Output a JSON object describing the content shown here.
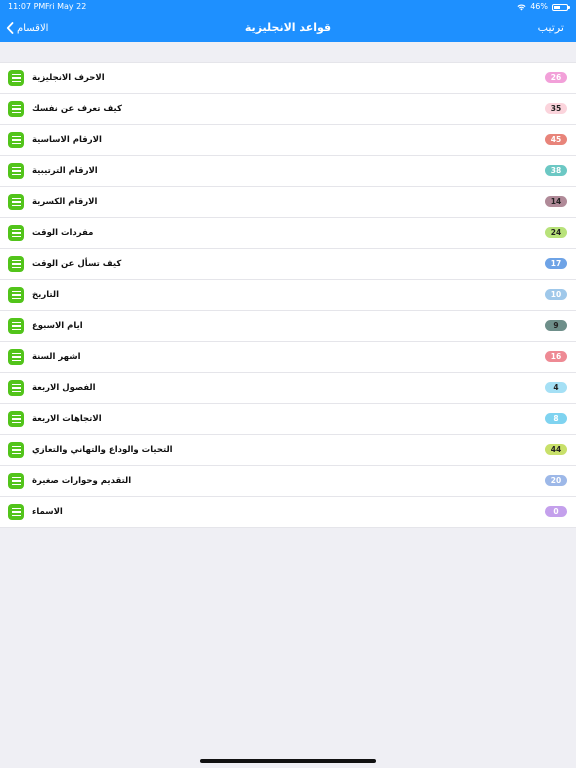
{
  "status_bar": {
    "time": "11:07 PM",
    "date": "Fri May 22",
    "battery_text": "46%",
    "battery_level": 0.46
  },
  "nav": {
    "title": "قواعد الانجليزية",
    "back_label": "الاقسام",
    "sort_label": "ترتيب",
    "color": "#1e90ff"
  },
  "items": [
    {
      "title": "الاحرف الانجليزية",
      "count": "26",
      "badge_color": "#f2a0d9",
      "text_color": "#ffffff"
    },
    {
      "title": "كيف تعرف عن نفسك",
      "count": "35",
      "badge_color": "#fbd4dc",
      "text_color": "#222222"
    },
    {
      "title": "الارقام الاساسية",
      "count": "45",
      "badge_color": "#e8847a",
      "text_color": "#ffffff"
    },
    {
      "title": "الارقام الترتيبية",
      "count": "38",
      "badge_color": "#6cc8c4",
      "text_color": "#ffffff"
    },
    {
      "title": "الارقام الكسرية",
      "count": "14",
      "badge_color": "#b08a98",
      "text_color": "#222222"
    },
    {
      "title": "مفردات الوقت",
      "count": "24",
      "badge_color": "#b8e27a",
      "text_color": "#222222"
    },
    {
      "title": "كيف تسأل عن الوقت",
      "count": "17",
      "badge_color": "#6ea3e6",
      "text_color": "#ffffff"
    },
    {
      "title": "التاريخ",
      "count": "10",
      "badge_color": "#9fc8ea",
      "text_color": "#ffffff"
    },
    {
      "title": "ايام الاسبوع",
      "count": "9",
      "badge_color": "#6e8f8a",
      "text_color": "#222222"
    },
    {
      "title": "اشهر السنة",
      "count": "16",
      "badge_color": "#ee8a94",
      "text_color": "#ffffff"
    },
    {
      "title": "الفصول الاربعة",
      "count": "4",
      "badge_color": "#a5e0f5",
      "text_color": "#222222"
    },
    {
      "title": "الاتجاهات الاربعة",
      "count": "8",
      "badge_color": "#7fd3f0",
      "text_color": "#ffffff"
    },
    {
      "title": "التحيات والوداع والتهاني والتعازي",
      "count": "44",
      "badge_color": "#c8e06a",
      "text_color": "#222222"
    },
    {
      "title": "التقديم وحوارات صغيرة",
      "count": "20",
      "badge_color": "#9db8e8",
      "text_color": "#ffffff"
    },
    {
      "title": "الاسماء",
      "count": "0",
      "badge_color": "#c4a0ec",
      "text_color": "#ffffff"
    }
  ]
}
